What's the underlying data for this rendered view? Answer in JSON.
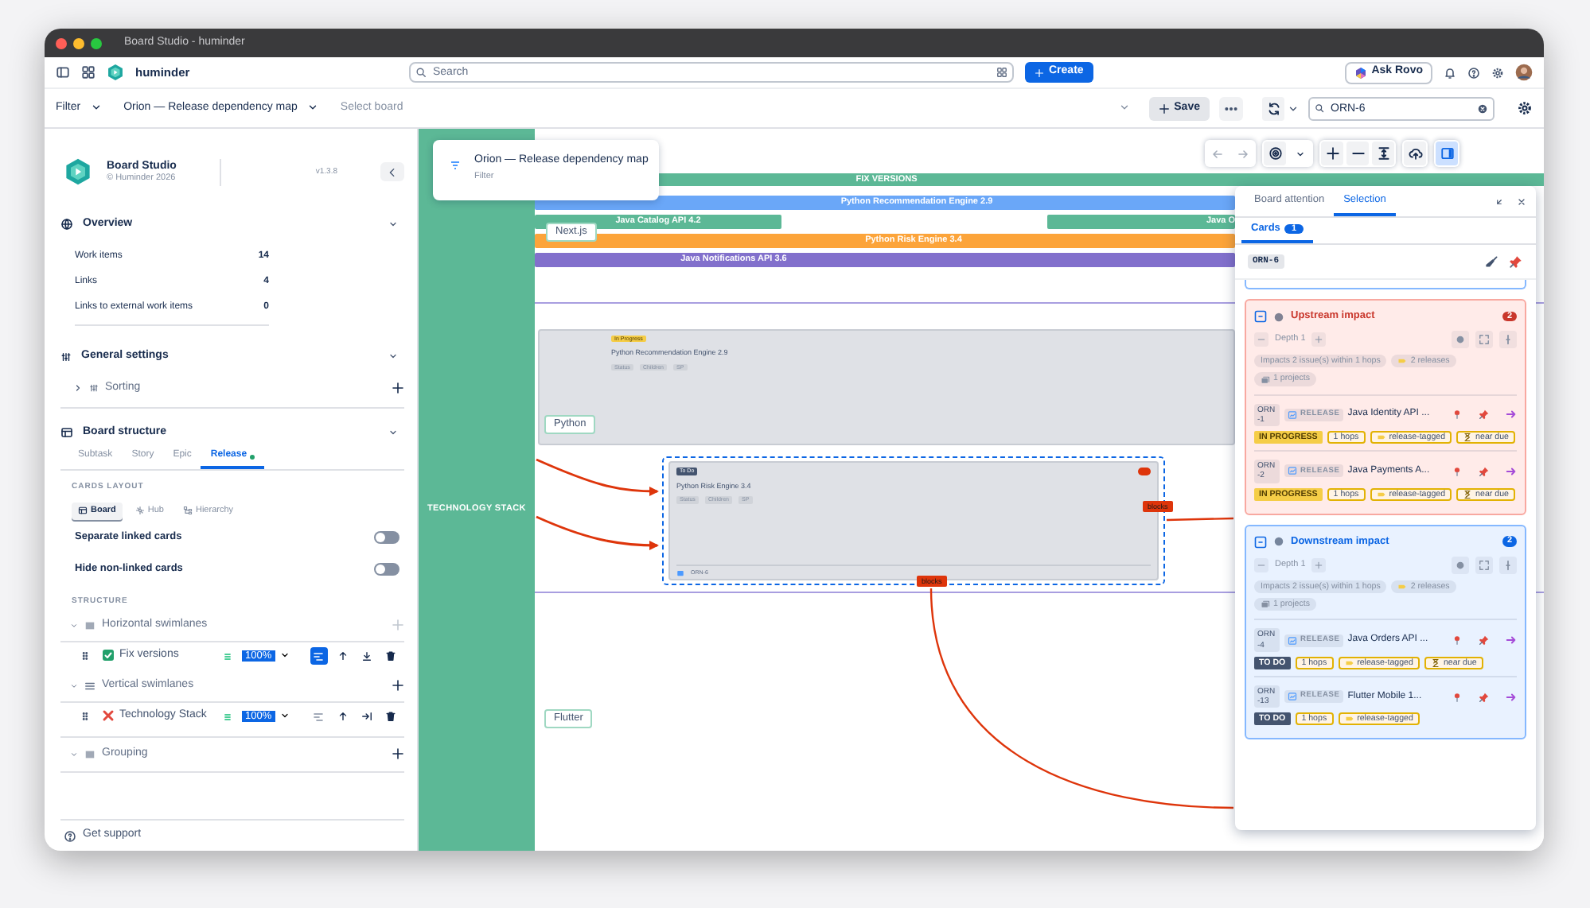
{
  "window": {
    "title": "Board Studio - huminder"
  },
  "top_bar": {
    "workspace": "huminder",
    "search": {
      "placeholder": "Search"
    },
    "create_button": "Create",
    "ask_button": "Ask Rovo"
  },
  "filter_bar": {
    "filter": "Filter",
    "board": "Orion — Release dependency map",
    "board_select": {
      "placeholder": "Select board"
    },
    "save_button": "Save",
    "search": {
      "value": "ORN-6"
    }
  },
  "sidebar": {
    "title": "Board Studio",
    "subtitle": "© Huminder 2026",
    "version": "v1.3.8",
    "overview": {
      "title": "Overview",
      "stats": [
        {
          "label": "Work items",
          "value": "14"
        },
        {
          "label": "Links",
          "value": "4"
        },
        {
          "label": "Links to external work items",
          "value": "0"
        }
      ]
    },
    "general_settings": {
      "title": "General settings",
      "items": [
        {
          "label": "Sorting",
          "expanded": false
        }
      ]
    },
    "board_structure": {
      "title": "Board structure",
      "tabs": [
        {
          "label": "Subtask",
          "selected": false,
          "dot": false
        },
        {
          "label": "Story",
          "selected": false,
          "dot": false
        },
        {
          "label": "Epic",
          "selected": false,
          "dot": false
        },
        {
          "label": "Release",
          "selected": true,
          "dot": true
        }
      ],
      "cards_layout": {
        "heading": "CARDS LAYOUT",
        "options": [
          {
            "kind": "board",
            "label": "Board",
            "selected": true
          },
          {
            "kind": "hub",
            "label": "Hub",
            "selected": false
          },
          {
            "kind": "hierarchy",
            "label": "Hierarchy",
            "selected": false
          }
        ]
      },
      "toggles": [
        {
          "label": "Separate linked cards",
          "on": false
        },
        {
          "label": "Hide non-linked cards",
          "on": false
        }
      ],
      "structure": {
        "heading": "STRUCTURE",
        "sections": [
          {
            "kind": "horizontal",
            "title": "Horizontal swimlanes",
            "add_disabled": true,
            "items": [
              {
                "label": "Fix versions",
                "enabled": true,
                "scale": "100%",
                "layout_active": true
              }
            ]
          },
          {
            "kind": "vertical",
            "title": "Vertical swimlanes",
            "add_disabled": false,
            "items": [
              {
                "label": "Technology Stack",
                "enabled": false,
                "scale": "100%",
                "layout_active": false
              }
            ]
          },
          {
            "kind": "grouping",
            "title": "Grouping",
            "add_disabled": false
          }
        ]
      }
    },
    "support": "Get support"
  },
  "canvas": {
    "popover": {
      "title": "Orion — Release dependency map",
      "subtitle": "Filter"
    },
    "fix_versions": "FIX VERSIONS",
    "column_header": "TECHNOLOGY STACK",
    "release_rows": [
      [
        {
          "name": "Python Recommendation Engine 2.9",
          "color": "#6aa7f8"
        }
      ],
      [
        {
          "name": "Java Catalog API 4.2",
          "color": "#5cb896"
        },
        {
          "name": "Java O",
          "color": "#5cb896"
        }
      ],
      [
        {
          "name": "Python Risk Engine 3.4",
          "color": "#fca43a"
        }
      ],
      [
        {
          "name": "Java Notifications API 3.6",
          "color": "#8270cc"
        }
      ]
    ],
    "lanes": [
      {
        "label": "Next.js"
      },
      {
        "label": "Python"
      },
      {
        "label": "Flutter"
      }
    ],
    "cards": [
      {
        "status": "In Progress",
        "color": "#f5cd47",
        "title": "Python Recommendation Engine 2.9",
        "fields": [
          "Status",
          "Children",
          "SP"
        ],
        "selected": false,
        "priority_badge": false
      },
      {
        "status": "To Do",
        "color": "#44546f",
        "title": "Python Risk Engine 3.4",
        "fields": [
          "Status",
          "Children",
          "SP"
        ],
        "key": "ORN-6",
        "selected": true,
        "priority_badge": true
      }
    ],
    "links": [
      {
        "label": "blocks"
      },
      {
        "label": "blocks"
      }
    ],
    "toolbar": {
      "panel_open": true
    }
  },
  "panel": {
    "tabs": [
      {
        "label": "Board attention",
        "selected": false
      },
      {
        "label": "Selection",
        "selected": true
      }
    ],
    "subtabs": [
      {
        "label": "Cards",
        "count": "1",
        "selected": true
      }
    ],
    "selected_key": "ORN-6",
    "impacts": [
      {
        "kind": "upstream",
        "title": "Upstream impact",
        "count": "2",
        "depth": "Depth 1",
        "summary": "Impacts 2 issue(s) within 1 hops",
        "releases": "2 releases",
        "projects": "1 projects",
        "items": [
          {
            "key": "ORN-1",
            "type": "RELEASE",
            "title": "Java Identity API ...",
            "status": "IN PROGRESS",
            "color": "#f5cd47",
            "hops": "1 hops",
            "tags": [
              {
                "kind": "release",
                "label": "release-tagged"
              },
              {
                "kind": "due",
                "label": "near due"
              }
            ]
          },
          {
            "key": "ORN-2",
            "type": "RELEASE",
            "title": "Java Payments A...",
            "status": "IN PROGRESS",
            "color": "#f5cd47",
            "hops": "1 hops",
            "tags": [
              {
                "kind": "release",
                "label": "release-tagged"
              },
              {
                "kind": "due",
                "label": "near due"
              }
            ]
          }
        ]
      },
      {
        "kind": "downstream",
        "title": "Downstream impact",
        "count": "2",
        "depth": "Depth 1",
        "summary": "Impacts 2 issue(s) within 1 hops",
        "releases": "2 releases",
        "projects": "1 projects",
        "items": [
          {
            "key": "ORN-4",
            "type": "RELEASE",
            "title": "Java Orders API ...",
            "status": "TO DO",
            "color": "#44546f",
            "hops": "1 hops",
            "tags": [
              {
                "kind": "release",
                "label": "release-tagged"
              },
              {
                "kind": "due",
                "label": "near due"
              }
            ]
          },
          {
            "key": "ORN-13",
            "type": "RELEASE",
            "title": "Flutter Mobile 1...",
            "status": "TO DO",
            "color": "#44546f",
            "hops": "1 hops",
            "tags": [
              {
                "kind": "release",
                "label": "release-tagged"
              }
            ]
          }
        ]
      }
    ]
  }
}
